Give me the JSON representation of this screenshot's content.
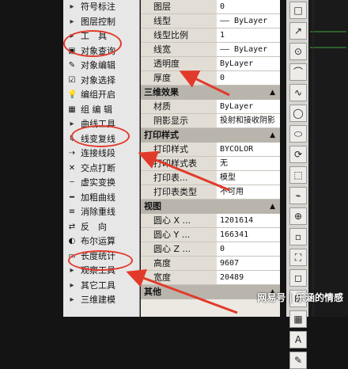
{
  "tool_menu": {
    "items": [
      {
        "label": "符号标注",
        "icon": "▸",
        "kind": "hdr"
      },
      {
        "label": "图层控制",
        "icon": "▸",
        "kind": "hdr"
      },
      {
        "label": "工　具",
        "icon": "▸",
        "kind": "hdr"
      },
      {
        "label": "对象查询",
        "icon": "▣",
        "kind": "sub"
      },
      {
        "label": "对象编辑",
        "icon": "✎",
        "kind": "sub"
      },
      {
        "label": "对象选择",
        "icon": "☑",
        "kind": "sub"
      },
      {
        "label": "编组开启",
        "icon": "💡",
        "kind": "sub"
      },
      {
        "label": "组 编 辑",
        "icon": "▦",
        "kind": "sub"
      },
      {
        "label": "曲线工具",
        "icon": "▸",
        "kind": "hdr"
      },
      {
        "label": "线变复线",
        "icon": "↳",
        "kind": "sub"
      },
      {
        "label": "连接线段",
        "icon": "⇢",
        "kind": "sub"
      },
      {
        "label": "交点打断",
        "icon": "✕",
        "kind": "sub"
      },
      {
        "label": "虚实变换",
        "icon": "┄",
        "kind": "sub"
      },
      {
        "label": "加粗曲线",
        "icon": "━",
        "kind": "sub"
      },
      {
        "label": "消除重线",
        "icon": "≡",
        "kind": "sub"
      },
      {
        "label": "反　向",
        "icon": "⇄",
        "kind": "sub"
      },
      {
        "label": "布尔运算",
        "icon": "◐",
        "kind": "sub"
      },
      {
        "label": "长度统计",
        "icon": "▭",
        "kind": "sub"
      },
      {
        "label": "观察工具",
        "icon": "▸",
        "kind": "hdr"
      },
      {
        "label": "其它工具",
        "icon": "▸",
        "kind": "hdr"
      },
      {
        "label": "三维建模",
        "icon": "▸",
        "kind": "hdr"
      }
    ]
  },
  "properties": {
    "general": [
      {
        "key": "图层",
        "value": "0"
      },
      {
        "key": "线型",
        "value": "—— ByLayer"
      },
      {
        "key": "线型比例",
        "value": "1"
      },
      {
        "key": "线宽",
        "value": "—— ByLayer"
      },
      {
        "key": "透明度",
        "value": "ByLayer"
      },
      {
        "key": "厚度",
        "value": "0"
      }
    ],
    "sections": [
      {
        "title": "三维效果",
        "rows": [
          {
            "key": "材质",
            "value": "ByLayer"
          },
          {
            "key": "阴影显示",
            "value": "投射和接收阴影"
          }
        ]
      },
      {
        "title": "打印样式",
        "rows": [
          {
            "key": "打印样式",
            "value": "BYCOLOR"
          },
          {
            "key": "打印样式表",
            "value": "无"
          },
          {
            "key": "打印表...",
            "value": "模型"
          },
          {
            "key": "打印表类型",
            "value": "不可用"
          }
        ]
      },
      {
        "title": "视图",
        "rows": [
          {
            "key": "圆心 X ...",
            "value": "1201614"
          },
          {
            "key": "圆心 Y ...",
            "value": "166341"
          },
          {
            "key": "圆心 Z ...",
            "value": "0"
          },
          {
            "key": "高度",
            "value": "9607"
          },
          {
            "key": "宽度",
            "value": "20489"
          }
        ]
      },
      {
        "title": "其他",
        "rows": []
      }
    ],
    "toggle": "▲"
  },
  "palette": {
    "tools": [
      "□",
      "↗",
      "⊙",
      "⌒",
      "∿",
      "◯",
      "⬭",
      "⟳",
      "⬚",
      "⌁",
      "⊕",
      "▫",
      "⛶",
      "◻",
      "⊞",
      "▦",
      "A",
      "✎"
    ]
  },
  "watermark": "网易号 | 乐涵的情感"
}
